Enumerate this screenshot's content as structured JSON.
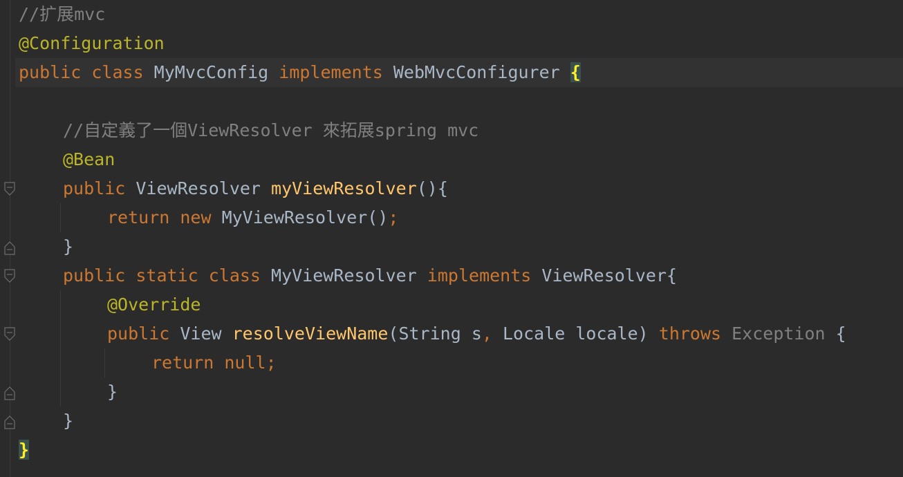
{
  "lines": [
    {
      "indent": 0,
      "tokens": [
        {
          "t": "comment",
          "v": "//扩展mvc"
        }
      ]
    },
    {
      "indent": 0,
      "tokens": [
        {
          "t": "anno",
          "v": "@Configuration"
        }
      ]
    },
    {
      "indent": 0,
      "tokens": [
        {
          "t": "kw",
          "v": "public class "
        },
        {
          "t": "text",
          "v": "MyMvcConfig "
        },
        {
          "t": "kw",
          "v": "implements "
        },
        {
          "t": "text",
          "v": "WebMvcConfigurer "
        },
        {
          "t": "brace",
          "v": "{"
        }
      ]
    },
    {
      "indent": 0,
      "tokens": []
    },
    {
      "indent": 1,
      "tokens": [
        {
          "t": "comment",
          "v": "//自定義了一個ViewResolver 來拓展spring mvc"
        }
      ]
    },
    {
      "indent": 1,
      "tokens": [
        {
          "t": "anno",
          "v": "@Bean"
        }
      ]
    },
    {
      "indent": 1,
      "tokens": [
        {
          "t": "kw",
          "v": "public "
        },
        {
          "t": "text",
          "v": "ViewResolver "
        },
        {
          "t": "method",
          "v": "myViewResolver"
        },
        {
          "t": "text",
          "v": "(){"
        }
      ]
    },
    {
      "indent": 2,
      "tokens": [
        {
          "t": "kw",
          "v": "return new "
        },
        {
          "t": "text",
          "v": "MyViewResolver()"
        },
        {
          "t": "kw",
          "v": ";"
        }
      ]
    },
    {
      "indent": 1,
      "tokens": [
        {
          "t": "text",
          "v": "}"
        }
      ]
    },
    {
      "indent": 1,
      "tokens": [
        {
          "t": "kw",
          "v": "public static class "
        },
        {
          "t": "text",
          "v": "MyViewResolver "
        },
        {
          "t": "kw",
          "v": "implements "
        },
        {
          "t": "text",
          "v": "ViewResolver{"
        }
      ]
    },
    {
      "indent": 2,
      "tokens": [
        {
          "t": "anno",
          "v": "@Override"
        }
      ]
    },
    {
      "indent": 2,
      "tokens": [
        {
          "t": "kw",
          "v": "public "
        },
        {
          "t": "text",
          "v": "View "
        },
        {
          "t": "method",
          "v": "resolveViewName"
        },
        {
          "t": "text",
          "v": "(String s"
        },
        {
          "t": "kw",
          "v": ", "
        },
        {
          "t": "text",
          "v": "Locale locale) "
        },
        {
          "t": "kw",
          "v": "throws "
        },
        {
          "t": "gray",
          "v": "Exception "
        },
        {
          "t": "text",
          "v": "{"
        }
      ]
    },
    {
      "indent": 3,
      "tokens": [
        {
          "t": "kw",
          "v": "return null;"
        }
      ]
    },
    {
      "indent": 2,
      "tokens": [
        {
          "t": "text",
          "v": "}"
        }
      ]
    },
    {
      "indent": 1,
      "tokens": [
        {
          "t": "text",
          "v": "}"
        }
      ]
    },
    {
      "indent": 0,
      "tokens": [
        {
          "t": "brace",
          "v": "}"
        }
      ]
    }
  ]
}
